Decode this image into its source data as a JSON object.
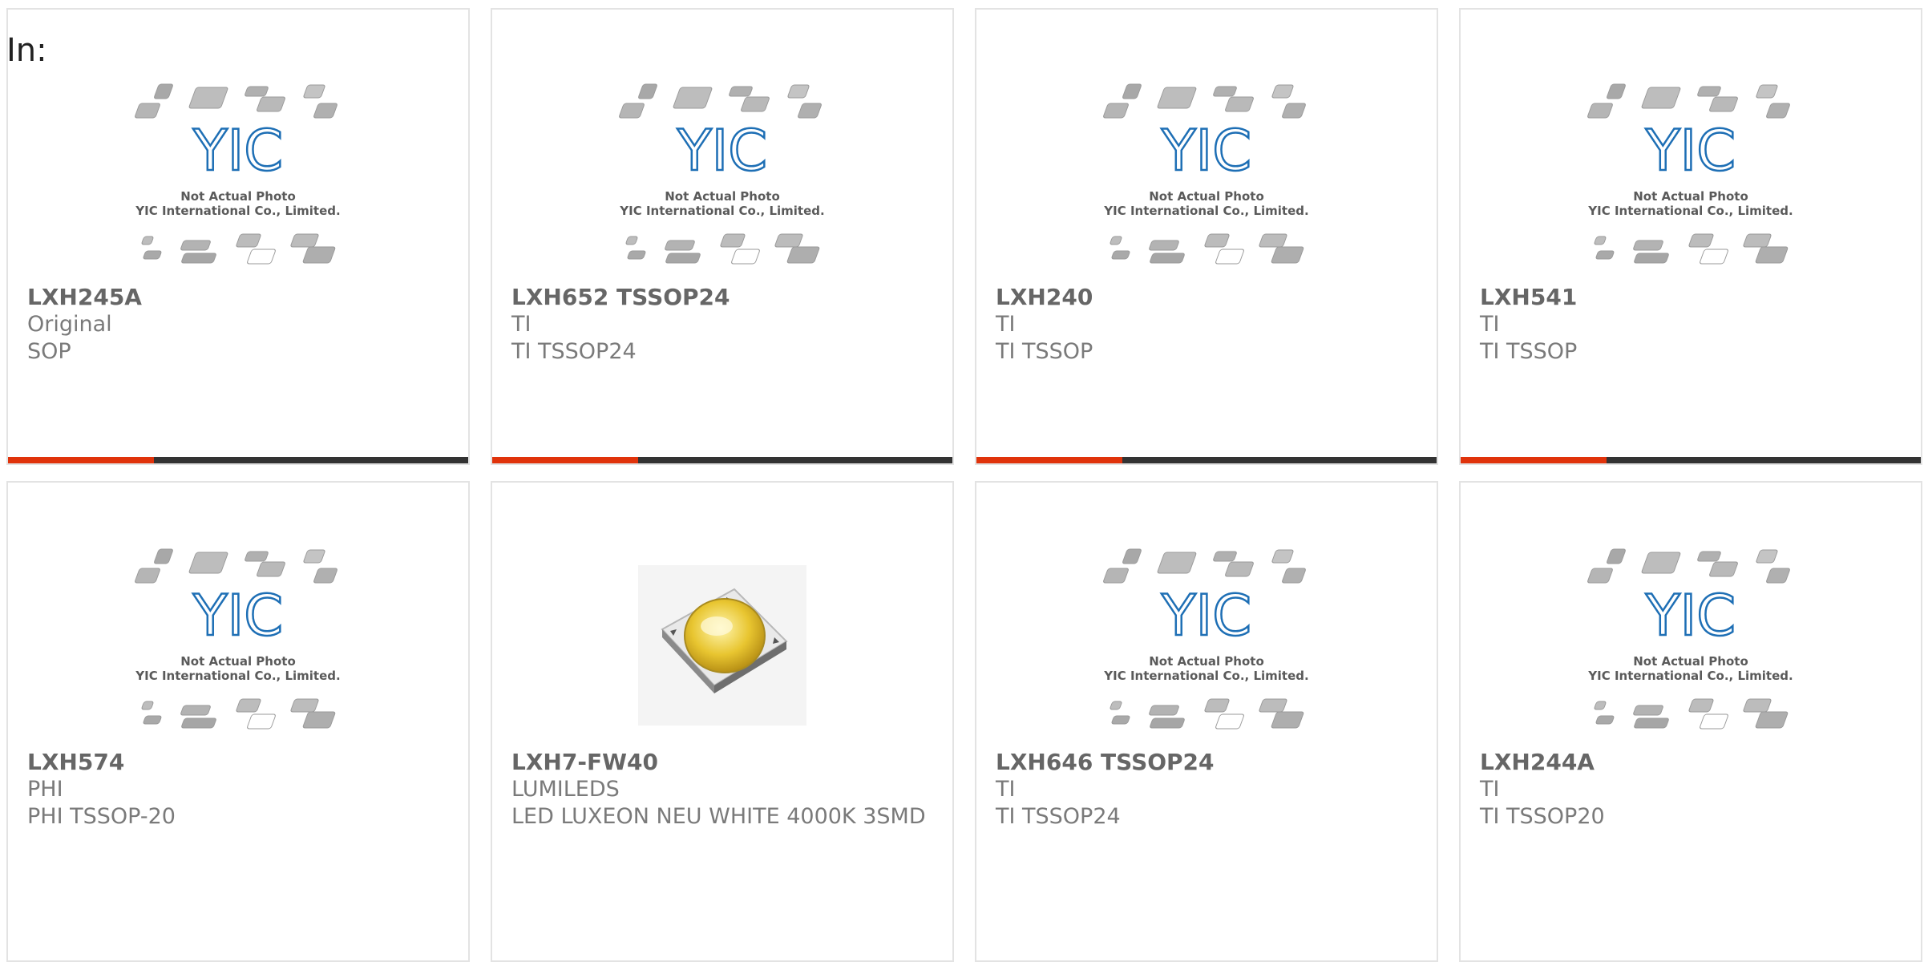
{
  "heading": "In:",
  "placeholder": {
    "line1": "Not Actual Photo",
    "line2": "YIC International Co., Limited.",
    "logo": "YIC"
  },
  "colors": {
    "accent": "#e0330b",
    "bar": "#333333",
    "logo_blue": "#1e6fb5"
  },
  "products": [
    {
      "part": "LXH245A",
      "maker": "Original",
      "desc": "SOP",
      "image": "placeholder"
    },
    {
      "part": "LXH652 TSSOP24",
      "maker": "TI",
      "desc": "TI TSSOP24",
      "image": "placeholder"
    },
    {
      "part": "LXH240",
      "maker": "TI",
      "desc": "TI TSSOP",
      "image": "placeholder"
    },
    {
      "part": "LXH541",
      "maker": "TI",
      "desc": "TI TSSOP",
      "image": "placeholder"
    },
    {
      "part": "LXH574",
      "maker": "PHI",
      "desc": "PHI TSSOP-20",
      "image": "placeholder"
    },
    {
      "part": "LXH7-FW40",
      "maker": "LUMILEDS",
      "desc": "LED LUXEON NEU WHITE 4000K 3SMD",
      "image": "led-photo"
    },
    {
      "part": "LXH646 TSSOP24",
      "maker": "TI",
      "desc": "TI TSSOP24",
      "image": "placeholder"
    },
    {
      "part": "LXH244A",
      "maker": "TI",
      "desc": "TI TSSOP20",
      "image": "placeholder"
    }
  ]
}
